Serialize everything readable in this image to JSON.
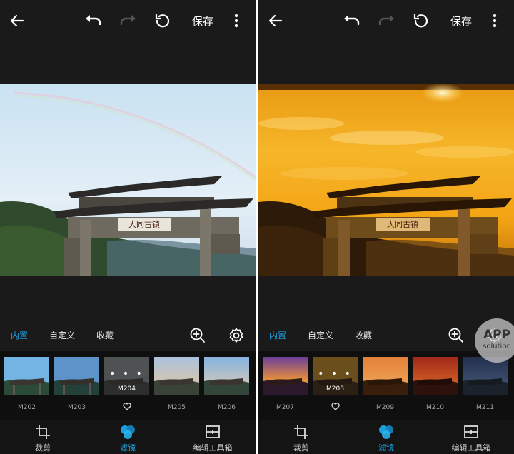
{
  "left": {
    "topbar": {
      "save_label": "保存"
    },
    "tabs": {
      "builtin": "内置",
      "custom": "自定义",
      "favorites": "收藏"
    },
    "filters": [
      {
        "name": "M202"
      },
      {
        "name": "M203"
      },
      {
        "name": "M204",
        "selected": true
      },
      {
        "name": "M205"
      },
      {
        "name": "M206"
      }
    ],
    "bottom_nav": {
      "crop": "裁剪",
      "filters": "滤镜",
      "toolbox": "编辑工具箱"
    }
  },
  "right": {
    "topbar": {
      "save_label": "保存"
    },
    "tabs": {
      "builtin": "内置",
      "custom": "自定义",
      "favorites": "收藏"
    },
    "filters": [
      {
        "name": "M207"
      },
      {
        "name": "M208",
        "selected": true
      },
      {
        "name": "M209"
      },
      {
        "name": "M210"
      },
      {
        "name": "M211"
      }
    ],
    "bottom_nav": {
      "crop": "裁剪",
      "filters": "滤镜",
      "toolbox": "编辑工具箱"
    }
  },
  "photo": {
    "plaque_text": "大同古镇"
  },
  "watermark": {
    "top": "APP",
    "bottom": "solution"
  },
  "colors": {
    "accent": "#1ba6e8",
    "background": "#1a1a1a",
    "strip": "#0f0f0f"
  },
  "icons": [
    "back-arrow-icon",
    "undo-icon",
    "redo-icon",
    "reset-icon",
    "more-vertical-icon",
    "zoom-in-icon",
    "gear-icon",
    "crop-icon",
    "filter-circles-icon",
    "toolbox-icon",
    "heart-icon"
  ]
}
